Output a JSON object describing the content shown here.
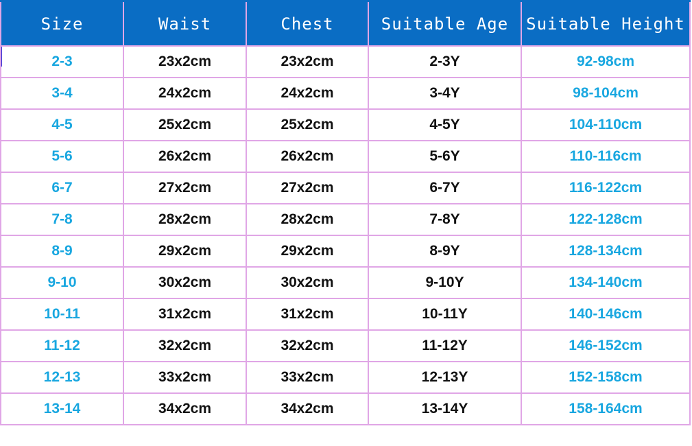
{
  "colors": {
    "header_bg": "#0a6dc4",
    "header_text": "#ffffff",
    "grid_line": "#e0a6e6",
    "accent_text": "#19a7e0",
    "body_text": "#111111"
  },
  "headers": [
    "Size",
    "Waist",
    "Chest",
    "Suitable Age",
    "Suitable Height"
  ],
  "rows": [
    [
      "2-3",
      "23x2cm",
      "23x2cm",
      "2-3Y",
      "92-98cm"
    ],
    [
      "3-4",
      "24x2cm",
      "24x2cm",
      "3-4Y",
      "98-104cm"
    ],
    [
      "4-5",
      "25x2cm",
      "25x2cm",
      "4-5Y",
      "104-110cm"
    ],
    [
      "5-6",
      "26x2cm",
      "26x2cm",
      "5-6Y",
      "110-116cm"
    ],
    [
      "6-7",
      "27x2cm",
      "27x2cm",
      "6-7Y",
      "116-122cm"
    ],
    [
      "7-8",
      "28x2cm",
      "28x2cm",
      "7-8Y",
      "122-128cm"
    ],
    [
      "8-9",
      "29x2cm",
      "29x2cm",
      "8-9Y",
      "128-134cm"
    ],
    [
      "9-10",
      "30x2cm",
      "30x2cm",
      "9-10Y",
      "134-140cm"
    ],
    [
      "10-11",
      "31x2cm",
      "31x2cm",
      "10-11Y",
      "140-146cm"
    ],
    [
      "11-12",
      "32x2cm",
      "32x2cm",
      "11-12Y",
      "146-152cm"
    ],
    [
      "12-13",
      "33x2cm",
      "33x2cm",
      "12-13Y",
      "152-158cm"
    ],
    [
      "13-14",
      "34x2cm",
      "34x2cm",
      "13-14Y",
      "158-164cm"
    ]
  ]
}
